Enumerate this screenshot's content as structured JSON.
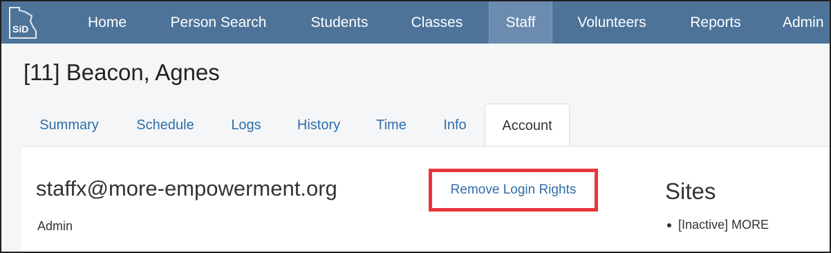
{
  "nav": {
    "logo_text": "SiD",
    "items": [
      {
        "label": "Home"
      },
      {
        "label": "Person Search"
      },
      {
        "label": "Students"
      },
      {
        "label": "Classes"
      },
      {
        "label": "Staff",
        "active": true
      },
      {
        "label": "Volunteers"
      },
      {
        "label": "Reports"
      },
      {
        "label": "Admin"
      }
    ]
  },
  "page": {
    "title": "[11] Beacon, Agnes"
  },
  "tabs": [
    {
      "label": "Summary"
    },
    {
      "label": "Schedule"
    },
    {
      "label": "Logs"
    },
    {
      "label": "History"
    },
    {
      "label": "Time"
    },
    {
      "label": "Info"
    },
    {
      "label": "Account",
      "active": true
    }
  ],
  "account": {
    "email": "staffx@more-empowerment.org",
    "role": "Admin",
    "remove_label": "Remove Login Rights"
  },
  "sites": {
    "title": "Sites",
    "items": [
      "[Inactive] MORE"
    ]
  },
  "colors": {
    "navbar": "#4d7399",
    "link": "#2f6da8",
    "highlight_border": "#e8353c"
  }
}
